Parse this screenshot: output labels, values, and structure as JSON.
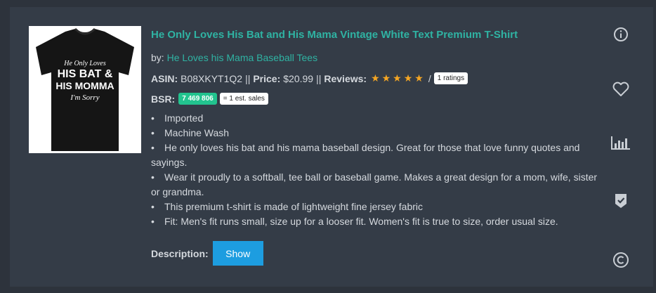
{
  "product": {
    "title": "He Only Loves His Bat and His Mama Vintage White Text Premium T-Shirt",
    "by_label": "by:",
    "brand": "He Loves his Mama Baseball Tees",
    "asin_label": "ASIN:",
    "asin": "B08XKYT1Q2",
    "sep1": "||",
    "price_label": "Price:",
    "price": "$20.99",
    "sep2": "||",
    "reviews_label": "Reviews:",
    "stars": "★★★★★",
    "rating_value": 5,
    "slash": "/",
    "ratings_count": "1 ratings",
    "bsr_label": "BSR:",
    "bsr_value": "7 469 806",
    "est_sales": "= 1 est. sales",
    "bullets": [
      "Imported",
      "Machine Wash",
      "He only loves his bat and his mama baseball design. Great for those that love funny quotes and sayings.",
      "Wear it proudly to a softball, tee ball or baseball game. Makes a great design for a mom, wife, sister or grandma.",
      "This premium t-shirt is made of lightweight fine jersey fabric",
      "Fit: Men's fit runs small, size up for a looser fit. Women's fit is true to size, order usual size."
    ],
    "description_label": "Description:",
    "show_label": "Show",
    "image_text": [
      "He Only Loves",
      "HIS BAT &",
      "HIS MOMMA",
      "I'm Sorry"
    ]
  },
  "side_icons": [
    "info-icon",
    "heart-icon",
    "bar-chart-icon",
    "shield-check-icon",
    "copyright-icon"
  ],
  "colors": {
    "background": "#2d333c",
    "card": "#343c47",
    "accent_teal": "#2fb3a3",
    "star": "#f5a623",
    "bsr_badge": "#22c38e",
    "button": "#1d9de0",
    "icon": "#c9ced4"
  }
}
